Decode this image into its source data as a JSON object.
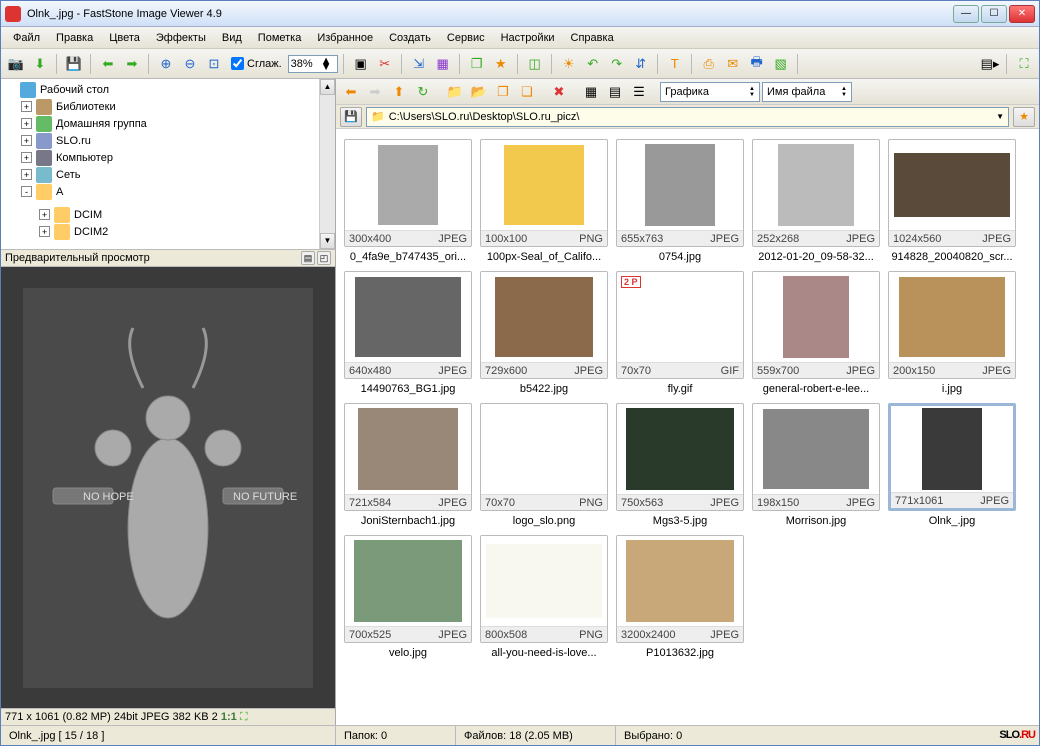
{
  "window": {
    "title": "Olnk_.jpg  -  FastStone Image Viewer 4.9"
  },
  "menu": [
    "Файл",
    "Правка",
    "Цвета",
    "Эффекты",
    "Вид",
    "Пометка",
    "Избранное",
    "Создать",
    "Сервис",
    "Настройки",
    "Справка"
  ],
  "toolbar": {
    "smooth_label": "Сглаж.",
    "zoom_value": "38%"
  },
  "tree": {
    "items": [
      {
        "label": "Рабочий стол",
        "icon": "desktop",
        "exp": "",
        "indent": 0
      },
      {
        "label": "Библиотеки",
        "icon": "lib",
        "exp": "+",
        "indent": 1
      },
      {
        "label": "Домашняя группа",
        "icon": "home",
        "exp": "+",
        "indent": 1
      },
      {
        "label": "SLO.ru",
        "icon": "drive",
        "exp": "+",
        "indent": 1
      },
      {
        "label": "Компьютер",
        "icon": "comp",
        "exp": "+",
        "indent": 1
      },
      {
        "label": "Сеть",
        "icon": "net",
        "exp": "+",
        "indent": 1
      },
      {
        "label": "A",
        "icon": "folder",
        "exp": "-",
        "indent": 1
      },
      {
        "label": "",
        "icon": "",
        "exp": "",
        "indent": 2,
        "spacer": true
      },
      {
        "label": "DCIM",
        "icon": "folder",
        "exp": "+",
        "indent": 2
      },
      {
        "label": "DCIM2",
        "icon": "folder",
        "exp": "+",
        "indent": 2
      }
    ]
  },
  "preview": {
    "header": "Предварительный просмотр",
    "info": "771 x 1061 (0.82 MP)  24bit  JPEG  382 KB  2",
    "ratio": "1:1"
  },
  "nav": {
    "view_label": "Графика",
    "sort_label": "Имя файла"
  },
  "path": "C:\\Users\\SLO.ru\\Desktop\\SLO.ru_picz\\",
  "thumbs": [
    {
      "dims": "300x400",
      "fmt": "JPEG",
      "name": "0_4fa9e_b747435_ori...",
      "w": 60,
      "h": 80,
      "bg": "#aaa"
    },
    {
      "dims": "100x100",
      "fmt": "PNG",
      "name": "100px-Seal_of_Califo...",
      "w": 80,
      "h": 80,
      "bg": "#f2c94c"
    },
    {
      "dims": "655x763",
      "fmt": "JPEG",
      "name": "0754.jpg",
      "w": 70,
      "h": 82,
      "bg": "#999"
    },
    {
      "dims": "252x268",
      "fmt": "JPEG",
      "name": "2012-01-20_09-58-32...",
      "w": 76,
      "h": 82,
      "bg": "#bbb"
    },
    {
      "dims": "1024x560",
      "fmt": "JPEG",
      "name": "914828_20040820_scr...",
      "w": 116,
      "h": 64,
      "bg": "#5a4a3a"
    },
    {
      "dims": "640x480",
      "fmt": "JPEG",
      "name": "14490763_BG1.jpg",
      "w": 106,
      "h": 80,
      "bg": "#666"
    },
    {
      "dims": "729x600",
      "fmt": "JPEG",
      "name": "b5422.jpg",
      "w": 98,
      "h": 80,
      "bg": "#8a6a4a"
    },
    {
      "dims": "70x70",
      "fmt": "GIF",
      "name": "fly.gif",
      "w": 70,
      "h": 70,
      "bg": "#fff",
      "badge": "2 P"
    },
    {
      "dims": "559x700",
      "fmt": "JPEG",
      "name": "general-robert-e-lee...",
      "w": 66,
      "h": 82,
      "bg": "#a88"
    },
    {
      "dims": "200x150",
      "fmt": "JPEG",
      "name": "i.jpg",
      "w": 106,
      "h": 80,
      "bg": "#b8925a"
    },
    {
      "dims": "721x584",
      "fmt": "JPEG",
      "name": "JoniSternbach1.jpg",
      "w": 100,
      "h": 82,
      "bg": "#998877"
    },
    {
      "dims": "70x70",
      "fmt": "PNG",
      "name": "logo_slo.png",
      "w": 70,
      "h": 70,
      "bg": "#fff"
    },
    {
      "dims": "750x563",
      "fmt": "JPEG",
      "name": "Mgs3-5.jpg",
      "w": 108,
      "h": 82,
      "bg": "#2a3a2a"
    },
    {
      "dims": "198x150",
      "fmt": "JPEG",
      "name": "Morrison.jpg",
      "w": 106,
      "h": 80,
      "bg": "#888"
    },
    {
      "dims": "771x1061",
      "fmt": "JPEG",
      "name": "Olnk_.jpg",
      "w": 60,
      "h": 82,
      "bg": "#3a3a3a",
      "selected": true
    },
    {
      "dims": "700x525",
      "fmt": "JPEG",
      "name": "velo.jpg",
      "w": 108,
      "h": 82,
      "bg": "#7a9a7a"
    },
    {
      "dims": "800x508",
      "fmt": "PNG",
      "name": "all-you-need-is-love...",
      "w": 116,
      "h": 74,
      "bg": "#f8f8f0"
    },
    {
      "dims": "3200x2400",
      "fmt": "JPEG",
      "name": "P1013632.jpg",
      "w": 108,
      "h": 82,
      "bg": "#c8a878"
    }
  ],
  "status": {
    "file": "Olnk_.jpg [ 15 / 18 ]",
    "folders": "Папок: 0",
    "files": "Файлов: 18 (2.05 MB)",
    "selected": "Выбрано: 0"
  },
  "brand": {
    "text": "SLO",
    "suffix": ".RU"
  }
}
